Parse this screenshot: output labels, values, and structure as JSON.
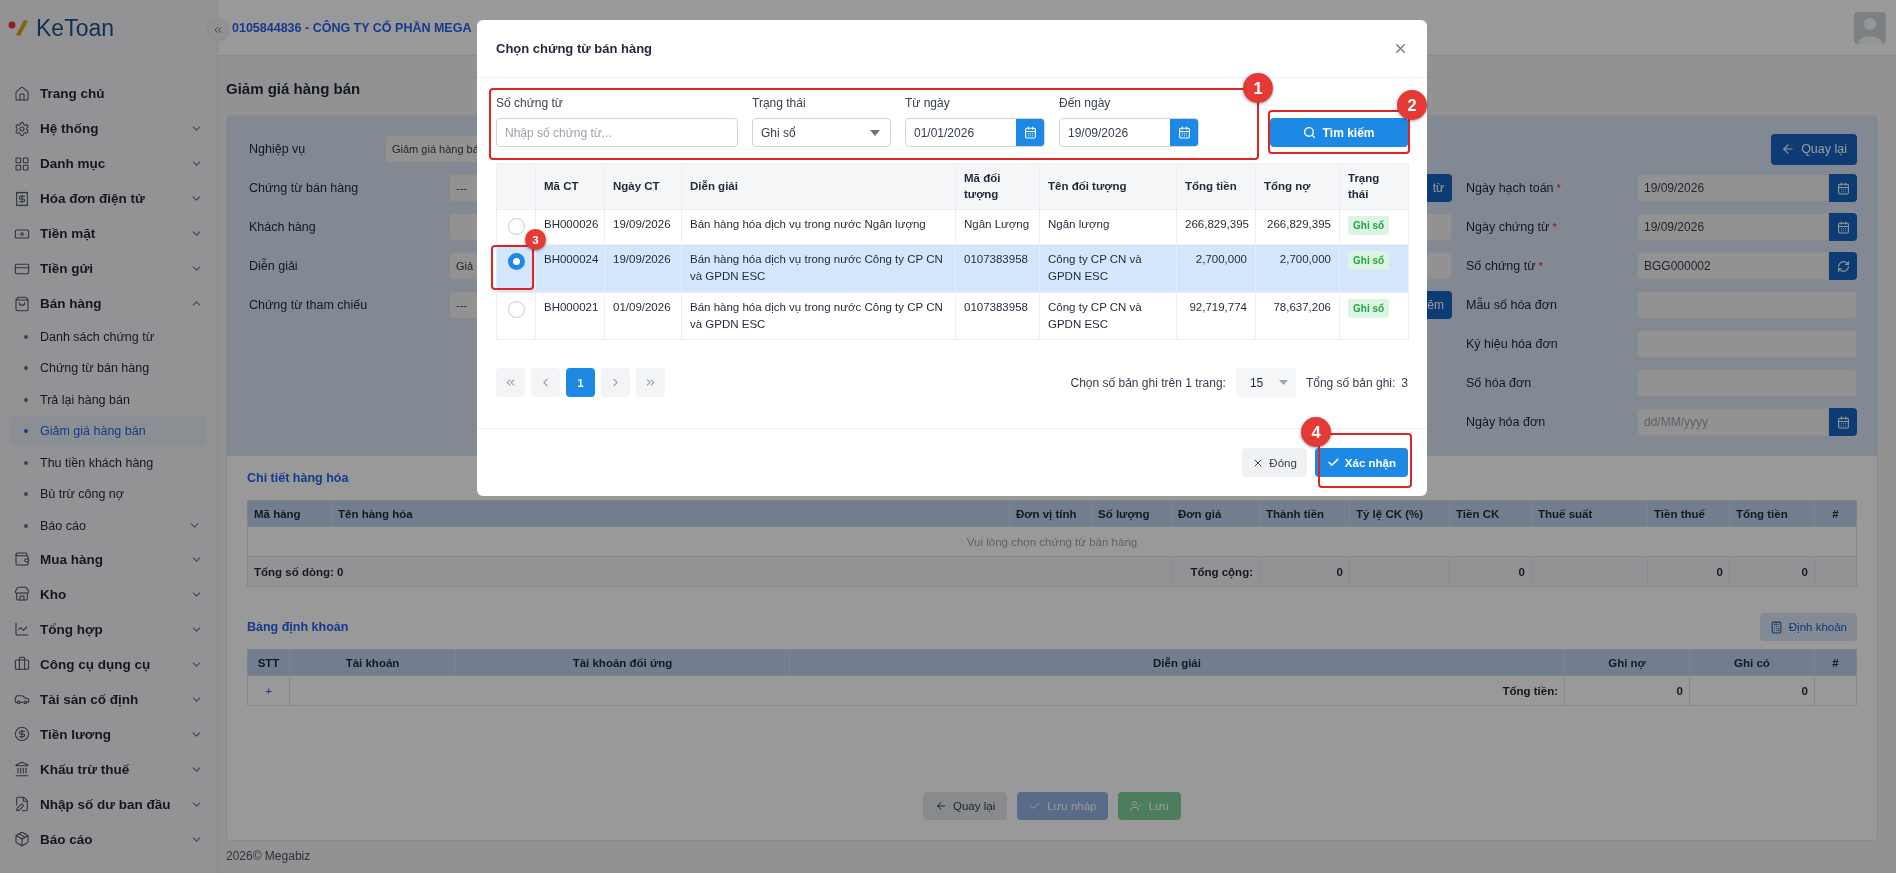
{
  "app": {
    "logo": "KeToan",
    "company": "0105844836 - CÔNG TY CỔ PHẦN MEGA"
  },
  "sidebar": {
    "items": [
      {
        "label": "Trang chủ"
      },
      {
        "label": "Hệ thống",
        "expanded": false
      },
      {
        "label": "Danh mục",
        "expanded": false
      },
      {
        "label": "Hóa đơn điện tử",
        "expanded": false
      },
      {
        "label": "Tiền mặt",
        "expanded": false
      },
      {
        "label": "Tiền gửi",
        "expanded": false
      },
      {
        "label": "Bán hàng",
        "expanded": true,
        "children": [
          {
            "label": "Danh sách chứng từ",
            "selected": false
          },
          {
            "label": "Chứng từ bán hàng",
            "selected": false
          },
          {
            "label": "Trả lại hàng bán",
            "selected": false
          },
          {
            "label": "Giảm giá hàng bán",
            "selected": true
          },
          {
            "label": "Thu tiền khách hàng",
            "selected": false
          },
          {
            "label": "Bù trừ công nợ",
            "selected": false
          },
          {
            "label": "Báo cáo",
            "selected": false,
            "expanded": false
          }
        ]
      },
      {
        "label": "Mua hàng",
        "expanded": false
      },
      {
        "label": "Kho",
        "expanded": false
      },
      {
        "label": "Tổng hợp",
        "expanded": false
      },
      {
        "label": "Công cụ dụng cụ",
        "expanded": false
      },
      {
        "label": "Tài sản cố định",
        "expanded": false
      },
      {
        "label": "Tiền lương",
        "expanded": false
      },
      {
        "label": "Khấu trừ thuế",
        "expanded": false
      },
      {
        "label": "Nhập số dư ban đầu",
        "expanded": false
      },
      {
        "label": "Báo cáo",
        "expanded": false
      }
    ]
  },
  "page": {
    "title": "Giảm giá hàng bán",
    "back_button": "Quay lại",
    "left_fields": [
      {
        "label": "Nghiệp vụ",
        "value": "Giảm giá hàng bá",
        "kind": "short"
      },
      {
        "label": "Chứng từ bán hàng",
        "value": "---",
        "kind": "button",
        "button": "từ"
      },
      {
        "label": "Khách hàng",
        "kind": "plain"
      },
      {
        "label": "Diễn giải",
        "value": "Giả",
        "kind": "plain"
      },
      {
        "label": "Chứng từ tham chiếu",
        "value": "---",
        "kind": "button",
        "button": "êm"
      }
    ],
    "right_fields": [
      {
        "label": "Ngày hạch toán",
        "mark": "*",
        "value": "19/09/2026",
        "kind": "calendar"
      },
      {
        "label": "Ngày chứng từ",
        "mark": "*",
        "value": "19/09/2026",
        "kind": "calendar"
      },
      {
        "label": "Số chứng từ",
        "mark": "*",
        "value": "BGG000002",
        "kind": "refresh"
      },
      {
        "label": "Mẫu số hóa đơn",
        "kind": "plain"
      },
      {
        "label": "Ký hiệu hóa đơn",
        "kind": "plain"
      },
      {
        "label": "Số hóa đơn",
        "kind": "plain"
      },
      {
        "label": "Ngày hóa đơn",
        "placeholder": "dd/MM/yyyy",
        "kind": "calendar"
      }
    ],
    "goods": {
      "title": "Chi tiết hàng hóa",
      "columns": [
        "Mã hàng",
        "Tên hàng hóa",
        "Đơn vị tính",
        "Số lượng",
        "Đơn giá",
        "Thành tiền",
        "Tỷ lệ CK (%)",
        "Tiền CK",
        "Thuế suất",
        "Tiền thuế",
        "Tổng tiền",
        "#"
      ],
      "empty_message": "Vui lòng chọn chứng từ bán hàng",
      "footer": {
        "row_count": "Tổng số dòng: 0",
        "total_label": "Tổng cộng:",
        "amount": "0",
        "discount": "0",
        "tax": "0",
        "grand_total": "0"
      }
    },
    "entries": {
      "title": "Bảng định khoản",
      "button": "Định khoản",
      "columns": [
        "STT",
        "Tài khoản",
        "Tài khoản đối ứng",
        "Diễn giải",
        "Ghi nợ",
        "Ghi có",
        "#"
      ],
      "add": "+",
      "total_label": "Tổng tiền:",
      "debit": "0",
      "credit": "0"
    },
    "actions": [
      {
        "label": "Quay lại",
        "kind": "back"
      },
      {
        "label": "Lưu nháp",
        "kind": "draft"
      },
      {
        "label": "Lưu",
        "kind": "save"
      }
    ],
    "footer": "2026© Megabiz"
  },
  "dialog": {
    "title": "Chọn chứng từ bán hàng",
    "filters": [
      {
        "kind": "text",
        "label": "Số chứng từ",
        "placeholder": "Nhập số chứng từ..."
      },
      {
        "kind": "select",
        "label": "Trạng thái",
        "value": "Ghi sổ"
      },
      {
        "kind": "date",
        "label": "Từ ngày",
        "value": "01/01/2026"
      },
      {
        "kind": "date",
        "label": "Đến ngày",
        "value": "19/09/2026"
      }
    ],
    "search_button": "Tìm kiếm",
    "columns": [
      "Mã CT",
      "Ngày CT",
      "Diễn giải",
      "Mã đối tượng",
      "Tên đối tượng",
      "Tổng tiền",
      "Tổng nợ",
      "Trạng thái"
    ],
    "rows": [
      {
        "selected": false,
        "cells": [
          "BH000026",
          "19/09/2026",
          "Bán hàng hóa dịch vụ trong nước Ngân lượng",
          "Ngân Lượng",
          "Ngân lượng",
          "266,829,395",
          "266,829,395"
        ],
        "status": "Ghi sổ"
      },
      {
        "selected": true,
        "cells": [
          "BH000024",
          "19/09/2026",
          "Bán hàng hóa dịch vụ trong nước Công ty CP CN và GPDN ESC",
          "0107383958",
          "Công ty CP CN và GPDN ESC",
          "2,700,000",
          "2,700,000"
        ],
        "status": "Ghi sổ"
      },
      {
        "selected": false,
        "cells": [
          "BH000021",
          "01/09/2026",
          "Bán hàng hóa dịch vụ trong nước Công ty CP CN và GPDN ESC",
          "0107383958",
          "Công ty CP CN và GPDN ESC",
          "92,719,774",
          "78,637,206"
        ],
        "status": "Ghi sổ"
      }
    ],
    "pagination": {
      "pages": [
        {
          "label": "1",
          "selected": true
        }
      ],
      "per_page_label": "Chọn số bản ghi trên 1 trang:",
      "per_page": "15",
      "total_label": "Tổng số bản ghi:",
      "total": "3"
    },
    "close_button": "Đóng",
    "confirm_button": "Xác nhận"
  },
  "annotations": [
    "1",
    "2",
    "3",
    "4"
  ]
}
